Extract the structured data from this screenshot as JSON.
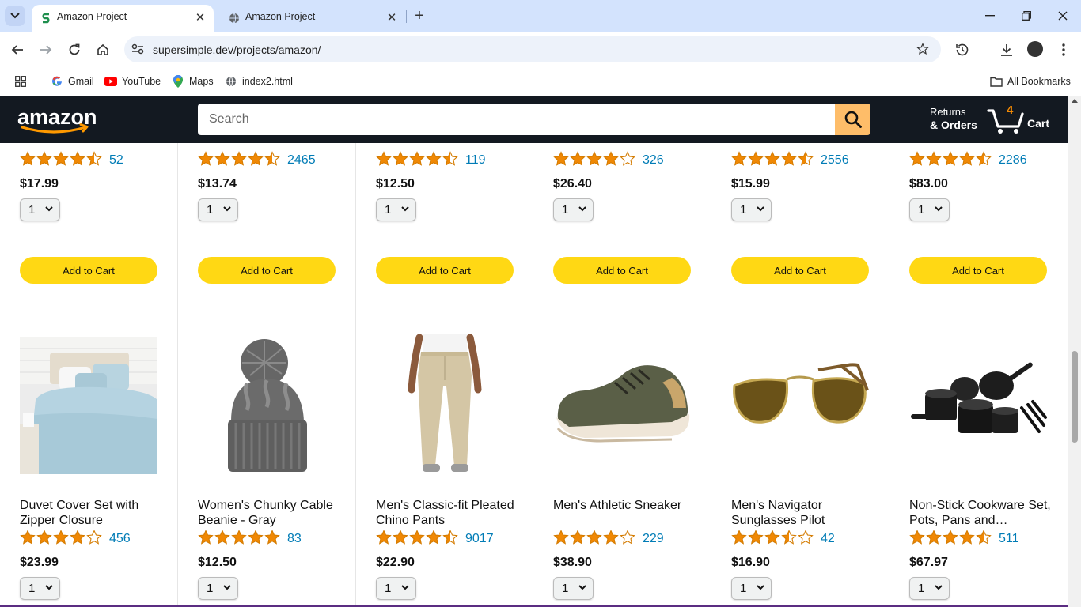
{
  "browser": {
    "tabs": [
      {
        "title": "Amazon Project",
        "active": true,
        "favicon": "supersimple-s-icon"
      },
      {
        "title": "Amazon Project",
        "active": false,
        "favicon": "globe-icon"
      }
    ],
    "url": "supersimple.dev/projects/amazon/",
    "bookmarks": [
      {
        "label": "Gmail",
        "icon": "google-icon"
      },
      {
        "label": "YouTube",
        "icon": "youtube-icon"
      },
      {
        "label": "Maps",
        "icon": "maps-icon"
      },
      {
        "label": "index2.html",
        "icon": "globe-icon"
      }
    ],
    "all_bookmarks": "All Bookmarks"
  },
  "header": {
    "logo": "amazon",
    "search_placeholder": "Search",
    "returns_line1": "Returns",
    "returns_line2": "& Orders",
    "cart_count": "4",
    "cart_label": "Cart"
  },
  "colors": {
    "header_bg": "#131921",
    "search_button": "#febd69",
    "add_to_cart": "#ffd814",
    "star": "#f08804",
    "rating_link": "#017cb6"
  },
  "products_top": [
    {
      "rating": 4.5,
      "rating_count": "52",
      "price": "$17.99",
      "qty": "1",
      "button": "Add to Cart"
    },
    {
      "rating": 4.5,
      "rating_count": "2465",
      "price": "$13.74",
      "qty": "1",
      "button": "Add to Cart"
    },
    {
      "rating": 4.5,
      "rating_count": "119",
      "price": "$12.50",
      "qty": "1",
      "button": "Add to Cart"
    },
    {
      "rating": 4.0,
      "rating_count": "326",
      "price": "$26.40",
      "qty": "1",
      "button": "Add to Cart"
    },
    {
      "rating": 4.5,
      "rating_count": "2556",
      "price": "$15.99",
      "qty": "1",
      "button": "Add to Cart"
    },
    {
      "rating": 4.5,
      "rating_count": "2286",
      "price": "$83.00",
      "qty": "1",
      "button": "Add to Cart"
    }
  ],
  "products_bottom": [
    {
      "name": "Duvet Cover Set with Zipper Closure",
      "image": "duvet-image",
      "rating": 4.0,
      "rating_count": "456",
      "price": "$23.99",
      "qty": "1"
    },
    {
      "name": "Women's Chunky Cable Beanie - Gray",
      "image": "beanie-image",
      "rating": 5.0,
      "rating_count": "83",
      "price": "$12.50",
      "qty": "1"
    },
    {
      "name": "Men's Classic-fit Pleated Chino Pants",
      "image": "chino-pants-image",
      "rating": 4.5,
      "rating_count": "9017",
      "price": "$22.90",
      "qty": "1"
    },
    {
      "name": "Men's Athletic Sneaker",
      "image": "sneaker-image",
      "rating": 4.0,
      "rating_count": "229",
      "price": "$38.90",
      "qty": "1"
    },
    {
      "name": "Men's Navigator Sunglasses Pilot",
      "image": "sunglasses-image",
      "rating": 3.5,
      "rating_count": "42",
      "price": "$16.90",
      "qty": "1"
    },
    {
      "name": "Non-Stick Cookware Set, Pots, Pans and…",
      "image": "cookware-image",
      "rating": 4.5,
      "rating_count": "511",
      "price": "$67.97",
      "qty": "1"
    }
  ]
}
